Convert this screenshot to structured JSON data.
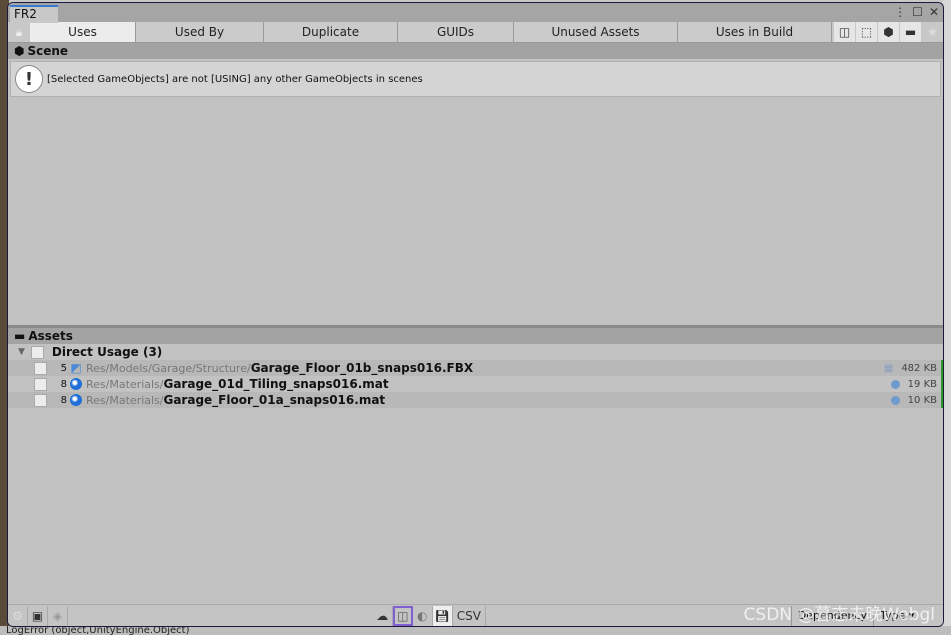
{
  "window": {
    "title": "FR2"
  },
  "tabs": [
    "Uses",
    "Used By",
    "Duplicate",
    "GUIDs",
    "Unused Assets",
    "Uses in Build"
  ],
  "active_tab": "Uses",
  "scene": {
    "header": "Scene",
    "message": "[Selected GameObjects] are not [USING] any other GameObjects in scenes"
  },
  "assets": {
    "header": "Assets",
    "group": "Direct Usage (3)",
    "items": [
      {
        "count": "5",
        "path": "Res/Models/Garage/Structure/",
        "name": "Garage_Floor_01b_snaps016.FBX",
        "size": "482 KB",
        "icon": "model-icon"
      },
      {
        "count": "8",
        "path": "Res/Materials/",
        "name": "Garage_01d_Tiling_snaps016.mat",
        "size": "19 KB",
        "icon": "material-icon"
      },
      {
        "count": "8",
        "path": "Res/Materials/",
        "name": "Garage_Floor_01a_snaps016.mat",
        "size": "10 KB",
        "icon": "material-icon"
      }
    ]
  },
  "footer": {
    "csv": "CSV",
    "dependency": "Dependency",
    "type": "Type"
  },
  "watermark": "CSDN @暮志未晚Webgl",
  "background_text": "LogError (object,UnityEngine.Object)"
}
